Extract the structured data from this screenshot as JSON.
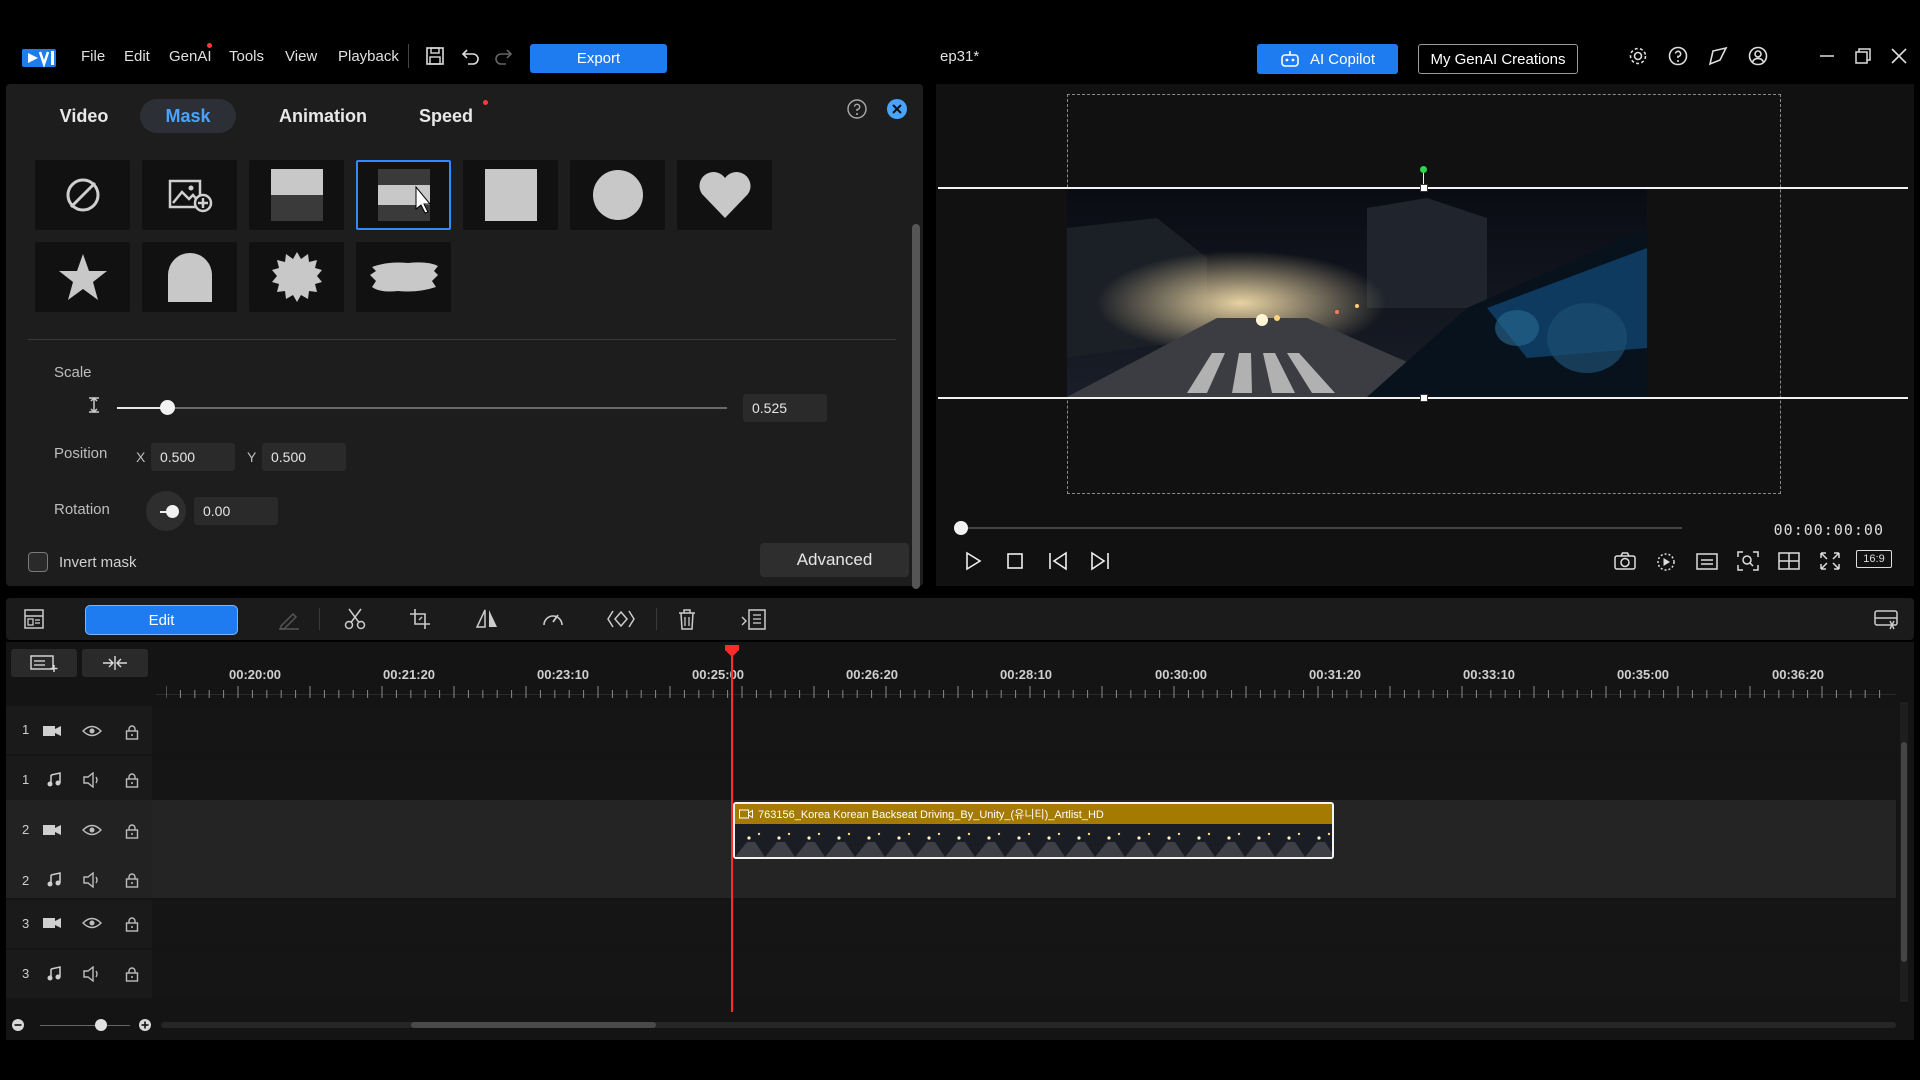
{
  "topbar": {
    "menu": [
      "File",
      "Edit",
      "GenAI",
      "Tools",
      "View",
      "Playback"
    ],
    "export_label": "Export",
    "project_title": "ep31*",
    "copilot_label": "AI Copilot",
    "genai_creations_label": "My GenAI Creations",
    "icons": [
      "settings-icon",
      "help-icon",
      "feedback-icon",
      "account-icon",
      "minimize-icon",
      "restore-icon",
      "close-icon"
    ]
  },
  "panel": {
    "tabs": [
      "Video",
      "Mask",
      "Animation",
      "Speed"
    ],
    "active_tab": "Mask",
    "scale_label": "Scale",
    "scale_value": "0.525",
    "position_label": "Position",
    "x_label": "X",
    "x_value": "0.500",
    "y_label": "Y",
    "y_value": "0.500",
    "rotation_label": "Rotation",
    "rotation_value": "0.00",
    "invert_mask_label": "Invert mask",
    "advanced_label": "Advanced"
  },
  "preview": {
    "timecode": "00:00:00:00",
    "aspect_label": "16:9"
  },
  "toolbar": {
    "edit_label": "Edit"
  },
  "timeline": {
    "ruler": [
      "00:20:00",
      "00:21:20",
      "00:23:10",
      "00:25:00",
      "00:26:20",
      "00:28:10",
      "00:30:00",
      "00:31:20",
      "00:33:10",
      "00:35:00",
      "00:36:20"
    ],
    "tracks": [
      {
        "num": "1",
        "type": "video"
      },
      {
        "num": "1",
        "type": "audio"
      },
      {
        "num": "2",
        "type": "video"
      },
      {
        "num": "2",
        "type": "audio"
      },
      {
        "num": "3",
        "type": "video"
      },
      {
        "num": "3",
        "type": "audio"
      }
    ],
    "clip_title": "763156_Korea Korean Backseat Driving_By_Unity_(유니티)_Artlist_HD"
  }
}
